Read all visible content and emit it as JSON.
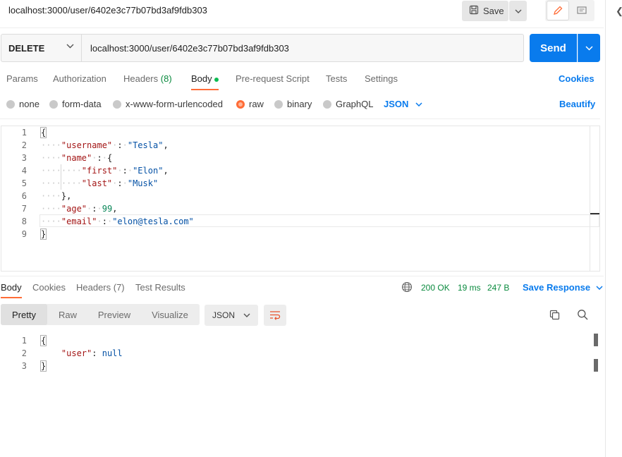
{
  "title": "localhost:3000/user/6402e3c77b07bd3af9fdb303",
  "toolbar": {
    "save_label": "Save"
  },
  "request": {
    "method": "DELETE",
    "url": "localhost:3000/user/6402e3c77b07bd3af9fdb303",
    "send_label": "Send"
  },
  "tabs": {
    "params": "Params",
    "authorization": "Authorization",
    "headers": "Headers",
    "headers_count": "(8)",
    "body": "Body",
    "prerequest": "Pre-request Script",
    "tests": "Tests",
    "settings": "Settings",
    "cookies": "Cookies"
  },
  "body_types": {
    "none": "none",
    "form_data": "form-data",
    "urlencoded": "x-www-form-urlencoded",
    "raw": "raw",
    "binary": "binary",
    "graphql": "GraphQL",
    "selected": "raw",
    "language": "JSON",
    "beautify": "Beautify"
  },
  "editor": {
    "line_numbers": [
      "1",
      "2",
      "3",
      "4",
      "5",
      "6",
      "7",
      "8",
      "9"
    ]
  },
  "response": {
    "tabs": {
      "body": "Body",
      "cookies": "Cookies",
      "headers": "Headers (7)",
      "test_results": "Test Results"
    },
    "status": "200 OK",
    "time": "19 ms",
    "size": "247 B",
    "save_response": "Save Response",
    "views": {
      "pretty": "Pretty",
      "raw": "Raw",
      "preview": "Preview",
      "visualize": "Visualize"
    },
    "format": "JSON",
    "line_numbers": [
      "1",
      "2",
      "3"
    ],
    "body_key": "\"user\"",
    "body_value": "null"
  },
  "icons": {
    "save": "save-icon",
    "edit": "pencil-icon",
    "comment": "comment-icon",
    "globe": "globe-icon",
    "copy": "copy-icon",
    "search": "search-icon",
    "wrap": "wrap-lines-icon"
  },
  "colors": {
    "accent": "#097bed",
    "tab_active": "#ff6c37",
    "success": "#0a8a3e"
  }
}
